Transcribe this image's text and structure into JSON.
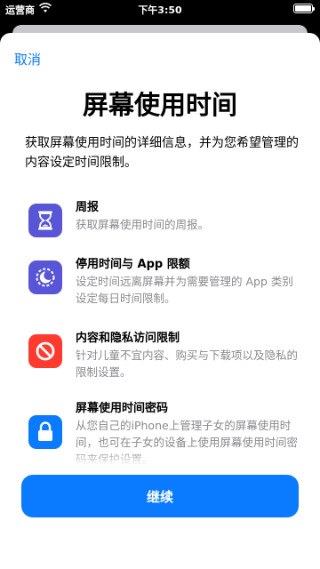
{
  "status_bar": {
    "carrier": "运营商",
    "time": "下午3:50"
  },
  "nav": {
    "cancel_label": "取消"
  },
  "page_title": "屏幕使用时间",
  "subtitle": "获取屏幕使用时间的详细信息，并为您希望管理的内容设定时间限制。",
  "features": [
    {
      "icon": "hourglass-icon",
      "color": "#5856d6",
      "title": "周报",
      "description": "获取屏幕使用时间的周报。"
    },
    {
      "icon": "downtime-moon-icon",
      "color": "#5856d6",
      "title": "停用时间与 App 限额",
      "description": "设定时间远离屏幕并为需要管理的 App 类别设定每日时间限制。"
    },
    {
      "icon": "restriction-icon",
      "color": "#ff3b30",
      "title": "内容和隐私访问限制",
      "description": "针对儿童不宜内容、购买与下载项以及隐私的限制设置。"
    },
    {
      "icon": "lock-icon",
      "color": "#0a7aff",
      "title": "屏幕使用时间密码",
      "description": "从您自己的iPhone上管理子女的屏幕使用时间，也可在子女的设备上使用屏幕使用时间密码来保护设置。"
    }
  ],
  "footer": {
    "continue_label": "继续"
  },
  "colors": {
    "accent": "#0a7aff"
  }
}
